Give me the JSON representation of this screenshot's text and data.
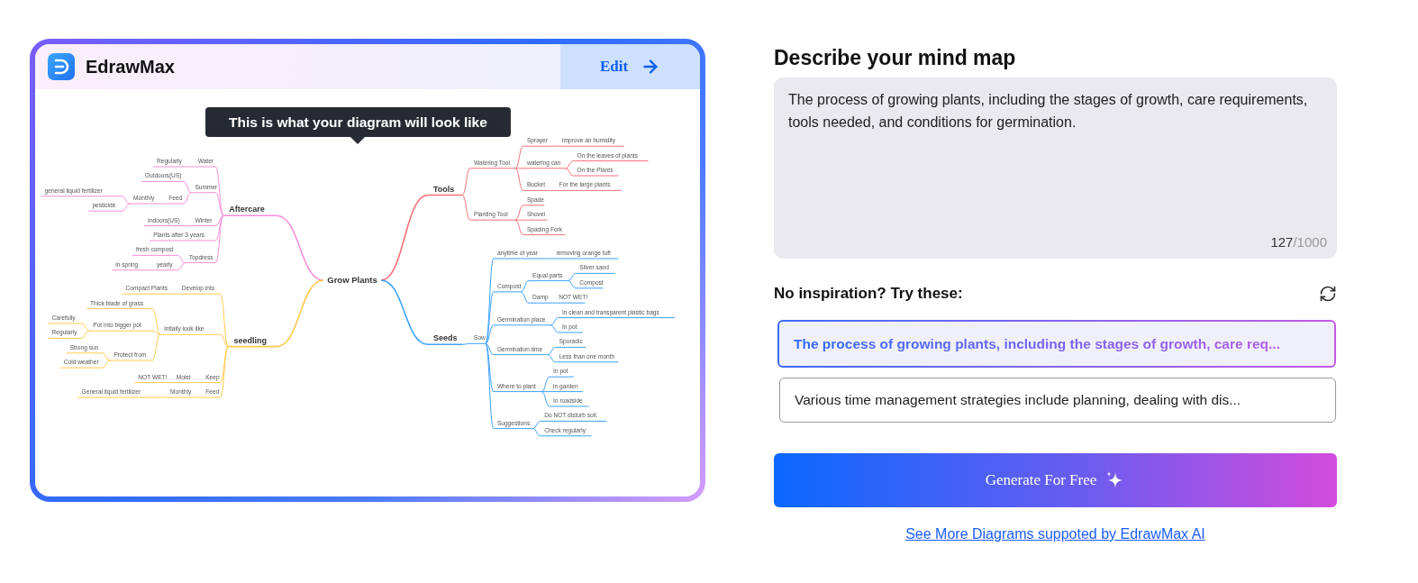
{
  "preview": {
    "brand": "EdrawMax",
    "edit_label": "Edit",
    "tooltip": "This is what your diagram will look like",
    "mind_map": {
      "root": "Grow Plants",
      "right_branches": [
        {
          "label": "Tools",
          "color": "#f8707c",
          "children": [
            {
              "label": "Watering Tool",
              "children": [
                {
                  "label": "Sprayer",
                  "children": [
                    {
                      "label": "improve air humidity"
                    }
                  ]
                },
                {
                  "label": "watering can",
                  "children": [
                    {
                      "label": "On the leaves of plants"
                    },
                    {
                      "label": "On the Plants"
                    }
                  ]
                },
                {
                  "label": "Bucket",
                  "children": [
                    {
                      "label": "For the large plants"
                    }
                  ]
                }
              ]
            },
            {
              "label": "Planting Tool",
              "children": [
                {
                  "label": "Spade"
                },
                {
                  "label": "Shovel"
                },
                {
                  "label": "Spading Fork"
                }
              ]
            }
          ]
        },
        {
          "label": "Seeds",
          "color": "#3ba2ff",
          "children": [
            {
              "label": "Sow",
              "children": [
                {
                  "label": "anytime of year",
                  "children": [
                    {
                      "label": "removing orange tuft"
                    }
                  ]
                },
                {
                  "label": "Compost",
                  "children": [
                    {
                      "label": "Equal parts",
                      "children": [
                        {
                          "label": "Silver sand"
                        },
                        {
                          "label": "Compost"
                        }
                      ]
                    },
                    {
                      "label": "Damp",
                      "children": [
                        {
                          "label": "NOT WET!"
                        }
                      ]
                    }
                  ]
                },
                {
                  "label": "Germination place",
                  "children": [
                    {
                      "label": "In clean and transparent plastic bags"
                    },
                    {
                      "label": "In pot"
                    }
                  ]
                },
                {
                  "label": "Germination time",
                  "children": [
                    {
                      "label": "Sporadic"
                    },
                    {
                      "label": "Less than one month"
                    }
                  ]
                },
                {
                  "label": "Where to plant",
                  "children": [
                    {
                      "label": "In pot"
                    },
                    {
                      "label": "in garden"
                    },
                    {
                      "label": "In roadside"
                    }
                  ]
                },
                {
                  "label": "Suggestions",
                  "children": [
                    {
                      "label": "Do NOT disturb soil."
                    },
                    {
                      "label": "Check regularly"
                    }
                  ]
                }
              ]
            }
          ]
        }
      ],
      "left_branches": [
        {
          "label": "Aftercare",
          "color": "#f78fd8",
          "children": [
            {
              "label": "Water",
              "children": [
                {
                  "label": "Regularly"
                }
              ]
            },
            {
              "label": "Summer",
              "children": [
                {
                  "label": "Outdoors(US)"
                },
                {
                  "label": "Feed",
                  "children": [
                    {
                      "label": "Monthly",
                      "children": [
                        {
                          "label": "general liquid fertilizer"
                        },
                        {
                          "label": "pesticide"
                        }
                      ]
                    }
                  ]
                }
              ]
            },
            {
              "label": "Winter",
              "children": [
                {
                  "label": "Indoors(US)"
                }
              ]
            },
            {
              "label": "Plants after 3 years"
            },
            {
              "label": "Topdress",
              "children": [
                {
                  "label": "fresh compost"
                },
                {
                  "label": "yearly",
                  "children": [
                    {
                      "label": "in spring"
                    }
                  ]
                }
              ]
            }
          ]
        },
        {
          "label": "seedling",
          "color": "#ffc94d",
          "children": [
            {
              "label": "Develop into",
              "children": [
                {
                  "label": "Compact Plants"
                }
              ]
            },
            {
              "label": "Intially look like",
              "children": [
                {
                  "label": "Thick blade of grass"
                },
                {
                  "label": "Pot into bigger pot",
                  "children": [
                    {
                      "label": "Carefully"
                    },
                    {
                      "label": "Regularly"
                    }
                  ]
                },
                {
                  "label": "Protect from",
                  "children": [
                    {
                      "label": "Strong sun"
                    },
                    {
                      "label": "Cold weather"
                    }
                  ]
                }
              ]
            },
            {
              "label": "Keep",
              "children": [
                {
                  "label": "Moist",
                  "children": [
                    {
                      "label": "NOT WET!"
                    }
                  ]
                }
              ]
            },
            {
              "label": "Feed",
              "children": [
                {
                  "label": "Monthly",
                  "children": [
                    {
                      "label": "General liquid fertilizer"
                    }
                  ]
                }
              ]
            }
          ]
        }
      ]
    }
  },
  "form": {
    "title": "Describe your mind map",
    "description": "The process of growing plants, including the stages of growth, care requirements, tools needed, and conditions for germination.",
    "count": "127",
    "limit": "/1000",
    "inspiration_label": "No inspiration? Try these:",
    "suggestions": [
      {
        "text": "The process of growing plants, including the stages of growth, care req...",
        "selected": true
      },
      {
        "text": "Various time management strategies include planning, dealing with dis...",
        "selected": false
      }
    ],
    "generate_label": "Generate For Free",
    "link": "See More Diagrams suppoted by EdrawMax AI"
  }
}
